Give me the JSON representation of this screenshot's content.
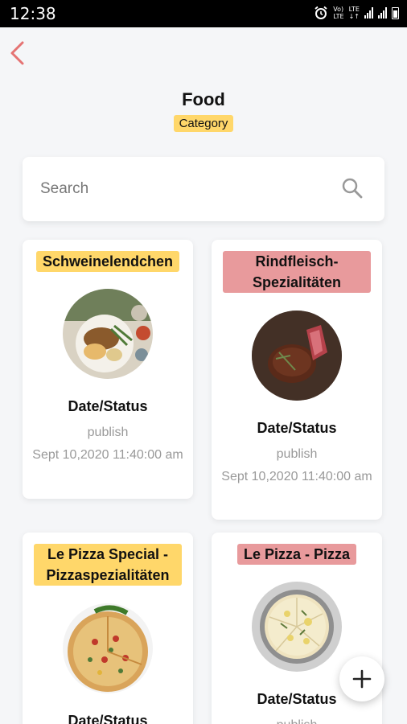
{
  "status_bar": {
    "time": "12:38",
    "volte": "Vo)",
    "lte": "LTE",
    "lte2": "LTE"
  },
  "header": {
    "title": "Food",
    "subtitle": "Category"
  },
  "search": {
    "placeholder": "Search"
  },
  "cards": [
    {
      "name": "Schweinelendchen",
      "tag_color": "#ffd76a",
      "label": "Date/Status",
      "status": "publish",
      "date": "Sept 10,2020 11:40:00 am"
    },
    {
      "name": "Rindfleisch-Spezialitäten",
      "tag_color": "#e89a9c",
      "label": "Date/Status",
      "status": "publish",
      "date": "Sept 10,2020 11:40:00 am"
    },
    {
      "name": "Le Pizza Special - Pizzaspezialitäten",
      "tag_color": "#ffd76a",
      "label": "Date/Status",
      "status": "",
      "date": ""
    },
    {
      "name": "Le Pizza - Pizza",
      "tag_color": "#e89a9c",
      "label": "Date/Status",
      "status": "publish",
      "date": ""
    }
  ],
  "colors": {
    "accent_yellow": "#ffd76a",
    "accent_red": "#e89a9c",
    "back_arrow": "#e57373"
  },
  "icons": {
    "back": "chevron-left-icon",
    "search": "search-icon",
    "add": "plus-icon"
  }
}
